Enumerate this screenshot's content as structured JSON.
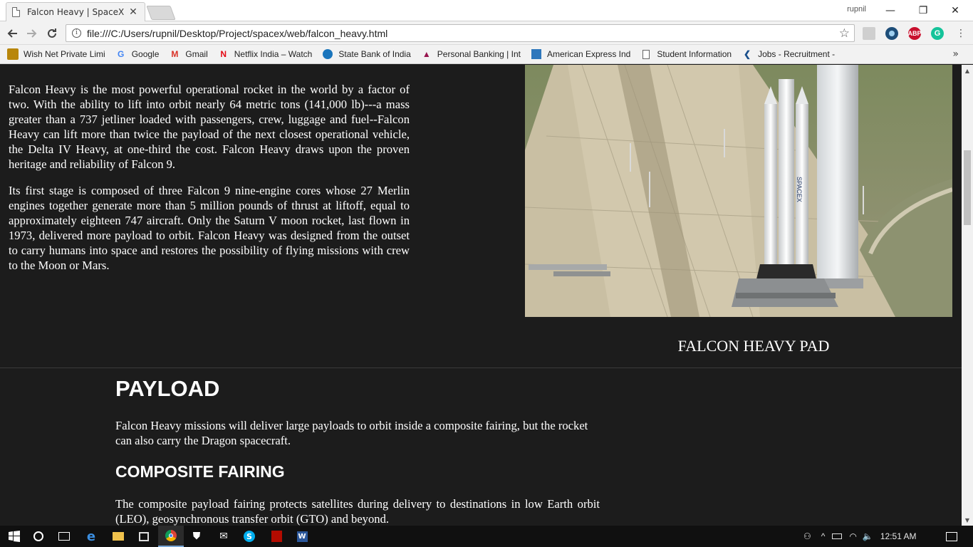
{
  "browser": {
    "tab_title": "Falcon Heavy | SpaceX",
    "tab_close": "✕",
    "user": "rupnil",
    "window_min": "—",
    "window_restore": "❐",
    "window_close": "✕",
    "url": "file:///C:/Users/rupnil/Desktop/Project/spacex/web/falcon_heavy.html",
    "abp_label": "ABP",
    "grammarly_label": "G",
    "bookmarks": [
      {
        "label": "Wish Net Private Limi",
        "icon": "wishnet-icon"
      },
      {
        "label": "Google",
        "icon": "google-icon"
      },
      {
        "label": "Gmail",
        "icon": "gmail-icon"
      },
      {
        "label": "Netflix India – Watch",
        "icon": "netflix-icon"
      },
      {
        "label": "State Bank of India",
        "icon": "sbi-icon"
      },
      {
        "label": "Personal Banking | Int",
        "icon": "axis-bank-icon"
      },
      {
        "label": "American Express Ind",
        "icon": "amex-icon"
      },
      {
        "label": "Student Information",
        "icon": "page-icon"
      },
      {
        "label": "Jobs - Recruitment -",
        "icon": "jobs-icon"
      }
    ],
    "bookmarks_more": "»"
  },
  "page": {
    "intro_paragraphs": [
      "Falcon Heavy is the most powerful operational rocket in the world by a factor of two. With the ability to lift into orbit nearly 64 metric tons (141,000 lb)---a mass greater than a 737 jetliner loaded with passengers, crew, luggage and fuel--Falcon Heavy can lift more than twice the payload of the next closest operational vehicle, the Delta IV Heavy, at one-third the cost. Falcon Heavy draws upon the proven heritage and reliability of Falcon 9.",
      "Its first stage is composed of three Falcon 9 nine-engine cores whose 27 Merlin engines together generate more than 5 million pounds of thrust at liftoff, equal to approximately eighteen 747 aircraft. Only the Saturn V moon rocket, last flown in 1973, delivered more payload to orbit. Falcon Heavy was designed from the outset to carry humans into space and restores the possibility of flying missions with crew to the Moon or Mars."
    ],
    "image_caption": "FALCON HEAVY PAD",
    "payload_heading": "PAYLOAD",
    "payload_text": "Falcon Heavy missions will deliver large payloads to orbit inside a composite fairing, but the rocket can also carry the Dragon spacecraft.",
    "fairing_heading": "COMPOSITE FAIRING",
    "fairing_text": "The composite payload fairing protects satellites during delivery to destinations in low Earth orbit (LEO), geosynchronous transfer orbit (GTO) and beyond.",
    "rocket_lettering": "SPACEX"
  },
  "taskbar": {
    "clock": "12:51 AM",
    "apps": [
      "start-icon",
      "cortana-icon",
      "task-view-icon",
      "edge-icon",
      "file-explorer-icon",
      "store-icon",
      "chrome-icon",
      "shield-icon",
      "mail-icon",
      "skype-icon",
      "acrobat-icon",
      "word-icon"
    ]
  },
  "colors": {
    "page_bg": "#1c1c1c",
    "text": "#ffffff",
    "chrome_bg": "#f2f2f2"
  }
}
